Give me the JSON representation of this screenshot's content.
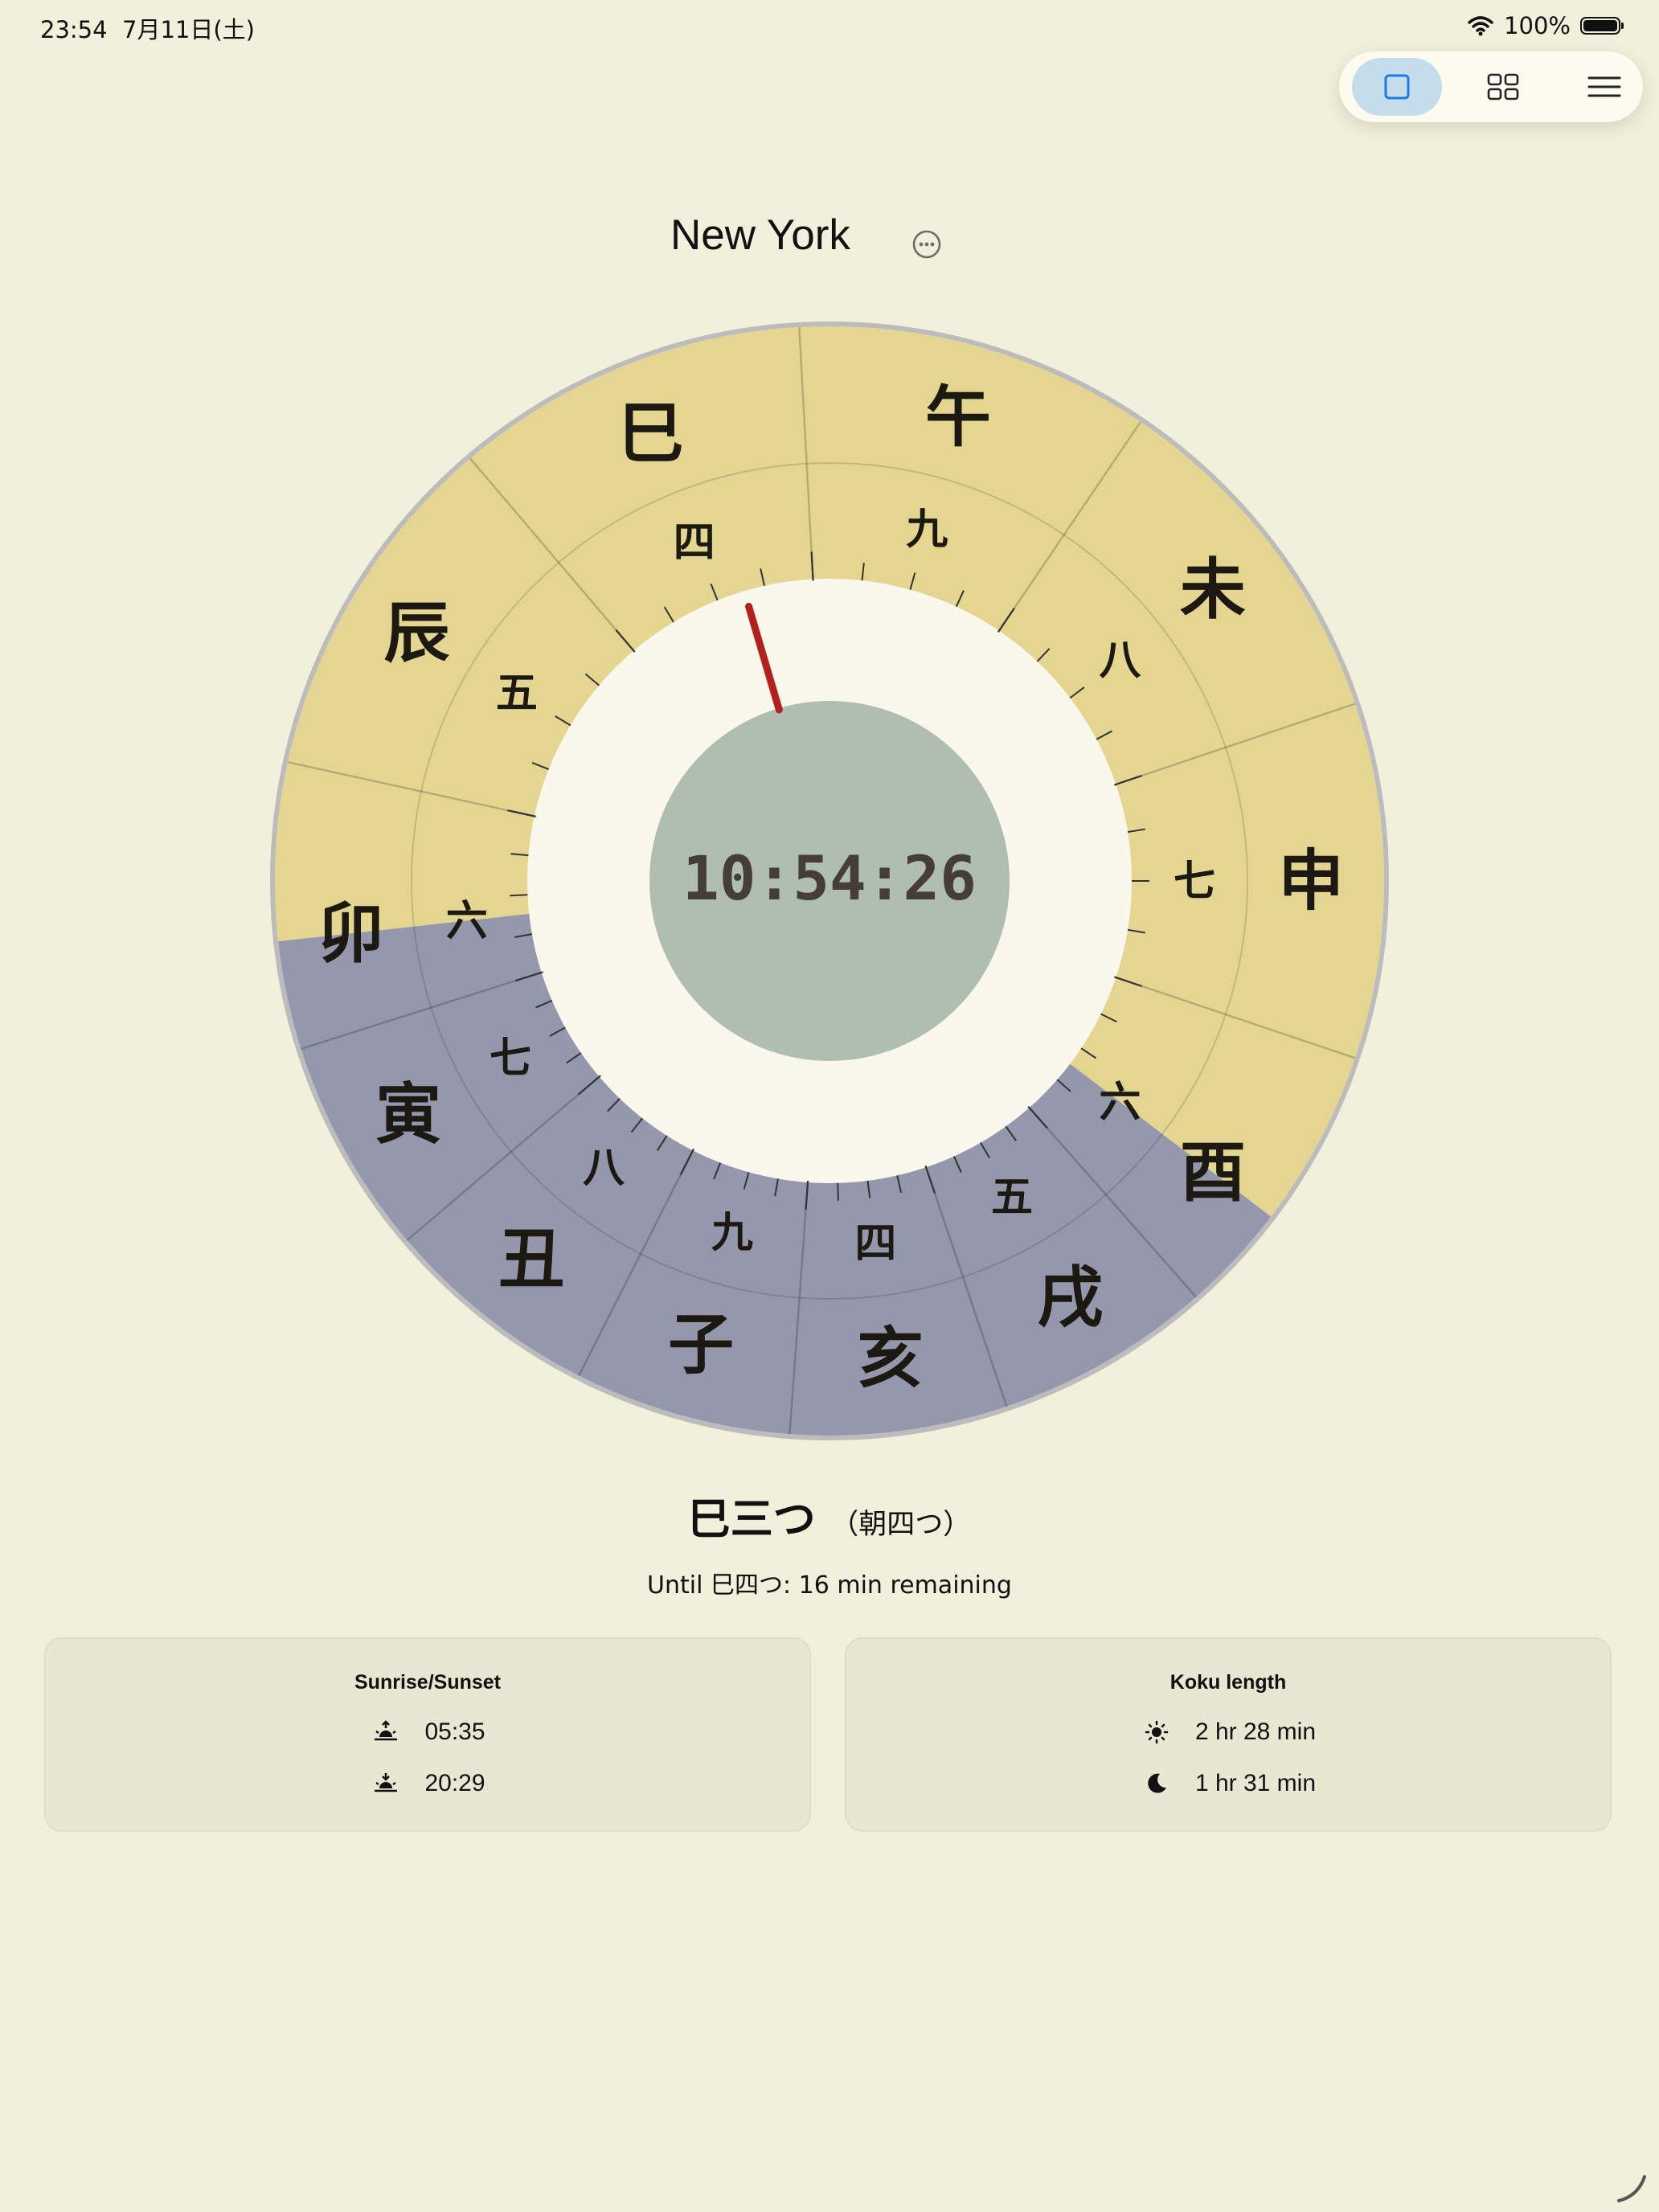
{
  "status_bar": {
    "time": "23:54",
    "date": "7月11日(土)",
    "battery": "100%"
  },
  "toolbar": {
    "single_icon": "single-view-icon",
    "grid_icon": "grid-view-icon",
    "menu_icon": "hamburger-menu-icon"
  },
  "header": {
    "city": "New York",
    "more_icon": "ellipsis-circle-icon"
  },
  "clock": {
    "digital_time": "10:54:26",
    "branches": [
      "午",
      "未",
      "申",
      "酉",
      "戌",
      "亥",
      "子",
      "丑",
      "寅",
      "卯",
      "辰",
      "巳"
    ],
    "inner_numerals": [
      "九",
      "八",
      "七",
      "六",
      "五",
      "四",
      "九",
      "八",
      "七",
      "六",
      "五",
      "四"
    ],
    "day_color": "#e4d691",
    "night_color": "#9598ad",
    "dial_color": "#faf8ec",
    "face_color": "#b0beb0",
    "hand_color": "#b1221e",
    "sunrise_hours": 5.583,
    "sunset_hours": 20.483,
    "current_hours": 10.907
  },
  "current_koku": {
    "name": "巳三つ",
    "alias": "（朝四つ）",
    "remaining": "Until 巳四つ: 16 min remaining"
  },
  "sun_card": {
    "title": "Sunrise/Sunset",
    "sunrise": "05:35",
    "sunset": "20:29",
    "sunrise_icon": "sunrise-icon",
    "sunset_icon": "sunset-icon"
  },
  "koku_card": {
    "title": "Koku length",
    "day": "2 hr 28 min",
    "night": "1 hr 31 min",
    "day_icon": "sun-icon",
    "night_icon": "moon-icon"
  }
}
